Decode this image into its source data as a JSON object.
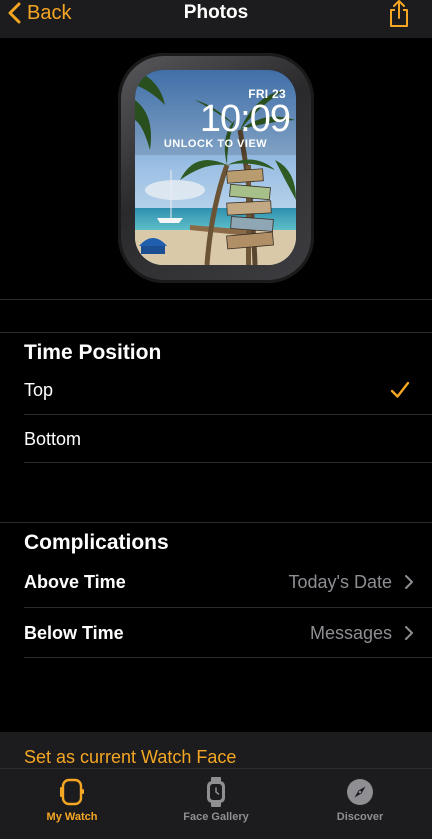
{
  "nav": {
    "back_label": "Back",
    "title": "Photos"
  },
  "watch": {
    "date": "FRI 23",
    "time": "10:09",
    "unlock_text": "UNLOCK TO VIEW"
  },
  "time_position": {
    "title": "Time Position",
    "options": [
      {
        "label": "Top",
        "selected": true
      },
      {
        "label": "Bottom",
        "selected": false
      }
    ]
  },
  "complications": {
    "title": "Complications",
    "rows": [
      {
        "label": "Above Time",
        "value": "Today's Date"
      },
      {
        "label": "Below Time",
        "value": "Messages"
      }
    ]
  },
  "action": {
    "set_face_label": "Set as current Watch Face"
  },
  "tabs": [
    {
      "label": "My Watch",
      "icon": "watch-icon",
      "active": true
    },
    {
      "label": "Face Gallery",
      "icon": "watch-face-icon",
      "active": false
    },
    {
      "label": "Discover",
      "icon": "compass-icon",
      "active": false
    }
  ],
  "colors": {
    "accent": "#f5a623",
    "background": "#000000",
    "surface": "#1c1c1e",
    "secondary_text": "#8e8e93",
    "inactive_tab": "#8e8e93"
  }
}
